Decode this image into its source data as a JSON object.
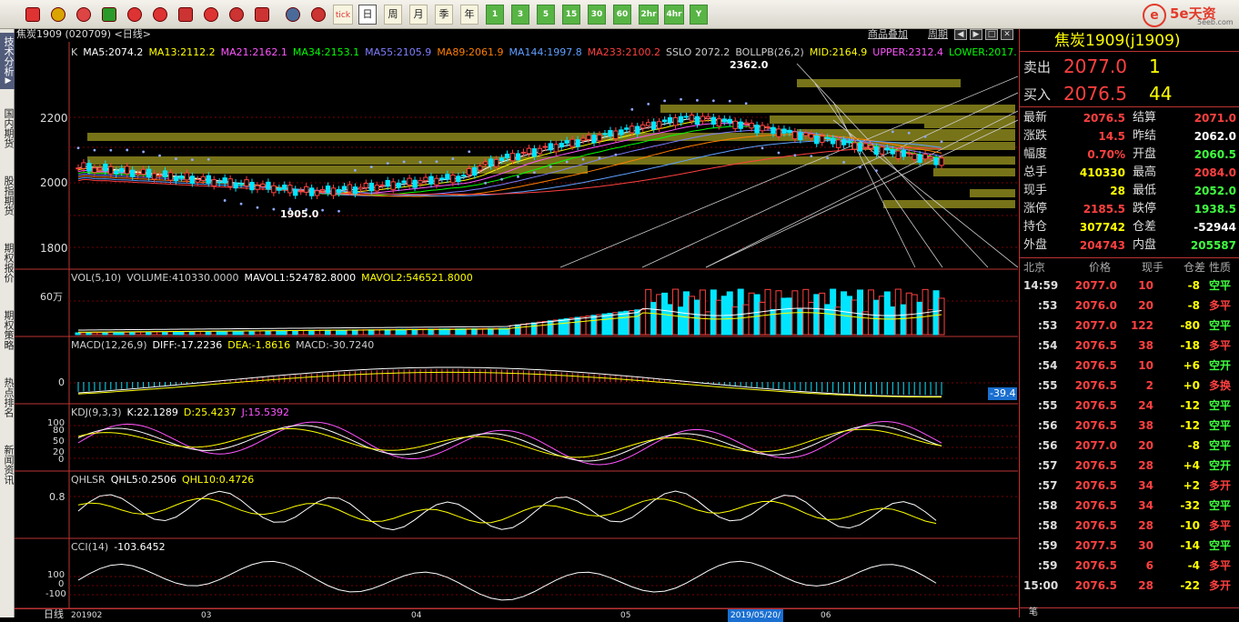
{
  "toolbar": {
    "buttons": [
      {
        "label": "",
        "icon": "home-icon",
        "kind": "ic"
      },
      {
        "label": "",
        "icon": "database-icon",
        "kind": "ic"
      },
      {
        "label": "",
        "icon": "f10-icon",
        "kind": "ic"
      },
      {
        "label": "",
        "icon": "refresh-icon",
        "kind": "ic"
      },
      {
        "label": "",
        "icon": "zoom-in-icon",
        "kind": "ic"
      },
      {
        "label": "",
        "icon": "zoom-out-icon",
        "kind": "ic"
      },
      {
        "label": "",
        "icon": "window-icon",
        "kind": "ic"
      },
      {
        "label": "",
        "icon": "pen-icon",
        "kind": "ic"
      },
      {
        "label": "",
        "icon": "edit-icon",
        "kind": "ic"
      },
      {
        "label": "",
        "icon": "filter-icon",
        "kind": "ic"
      },
      {
        "label": "",
        "icon": "table-icon",
        "kind": "ic"
      },
      {
        "label": "",
        "icon": "line-chart-icon",
        "kind": "ic"
      },
      {
        "label": "tick",
        "icon": "tick-icon",
        "kind": "tx"
      },
      {
        "label": "日",
        "kind": "tx",
        "selected": true
      },
      {
        "label": "周",
        "kind": "tx"
      },
      {
        "label": "月",
        "kind": "tx"
      },
      {
        "label": "季",
        "kind": "tx"
      },
      {
        "label": "年",
        "kind": "tx"
      },
      {
        "label": "1",
        "kind": "num"
      },
      {
        "label": "3",
        "kind": "num"
      },
      {
        "label": "5",
        "kind": "num"
      },
      {
        "label": "15",
        "kind": "num"
      },
      {
        "label": "30",
        "kind": "num"
      },
      {
        "label": "60",
        "kind": "num"
      },
      {
        "label": "2hr",
        "kind": "num"
      },
      {
        "label": "4hr",
        "kind": "num"
      },
      {
        "label": "Y",
        "kind": "num"
      }
    ]
  },
  "logo": {
    "mark": "e",
    "name": "5e天资",
    "site": "5eeb.com"
  },
  "leftbar": {
    "tabs": [
      "技术分析",
      "国内期货",
      "股指期货",
      "期权报价",
      "期权策略",
      "热点排名",
      "新闻资讯"
    ]
  },
  "chart": {
    "title": "焦炭1909 (020709) <日线>",
    "links": [
      "商品叠加",
      "周期"
    ],
    "main_legend": [
      {
        "t": "K",
        "c": "#cccccc"
      },
      {
        "t": "MA5:2074.2",
        "c": "#ffffff"
      },
      {
        "t": "MA13:2112.2",
        "c": "#ffff00"
      },
      {
        "t": "MA21:2162.1",
        "c": "#ff55ff"
      },
      {
        "t": "MA34:2153.1",
        "c": "#00ff00"
      },
      {
        "t": "MA55:2105.9",
        "c": "#7f7fff"
      },
      {
        "t": "MA89:2061.9",
        "c": "#ff7f00"
      },
      {
        "t": "MA144:1997.8",
        "c": "#5f9fff"
      },
      {
        "t": "MA233:2100.2",
        "c": "#ff4040"
      },
      {
        "t": "SSLO 2072.2",
        "c": "#cccccc"
      },
      {
        "t": "BOLLPB(26,2)",
        "c": "#cccccc"
      },
      {
        "t": "MID:2164.9",
        "c": "#ffff00"
      },
      {
        "t": "UPPER:2312.4",
        "c": "#ff55ff"
      },
      {
        "t": "LOWER:2017.",
        "c": "#00ff00"
      }
    ],
    "price_labels": [
      "2200",
      "2000",
      "1800"
    ],
    "high_mark": "2362.0",
    "low_mark": "1905.0",
    "vol_legend": [
      {
        "t": "VOL(5,10)",
        "c": "#cccccc"
      },
      {
        "t": "VOLUME:410330.0000",
        "c": "#cccccc"
      },
      {
        "t": "MAVOL1:524782.8000",
        "c": "#ffffff"
      },
      {
        "t": "MAVOL2:546521.8000",
        "c": "#ffff00"
      }
    ],
    "vol_label": "60万",
    "macd_legend": [
      {
        "t": "MACD(12,26,9)",
        "c": "#cccccc"
      },
      {
        "t": "DIFF:-17.2236",
        "c": "#ffffff"
      },
      {
        "t": "DEA:-1.8616",
        "c": "#ffff00"
      },
      {
        "t": "MACD:-30.7240",
        "c": "#cccccc"
      }
    ],
    "macd_label": "0",
    "macd_value": "-39.4",
    "kdj_legend": [
      {
        "t": "KDJ(9,3,3)",
        "c": "#cccccc"
      },
      {
        "t": "K:22.1289",
        "c": "#ffffff"
      },
      {
        "t": "D:25.4237",
        "c": "#ffff00"
      },
      {
        "t": "J:15.5392",
        "c": "#ff55ff"
      }
    ],
    "kdj_labels": [
      "100",
      "80",
      "50",
      "20",
      "0"
    ],
    "qhl_legend": [
      {
        "t": "QHLSR",
        "c": "#cccccc"
      },
      {
        "t": "QHL5:0.2506",
        "c": "#ffffff"
      },
      {
        "t": "QHL10:0.4726",
        "c": "#ffff00"
      }
    ],
    "qhl_label": "0.8",
    "cci_legend": [
      {
        "t": "CCI(14)",
        "c": "#cccccc"
      },
      {
        "t": "-103.6452",
        "c": "#ffffff"
      }
    ],
    "cci_labels": [
      "100",
      "0",
      "-100"
    ],
    "date_corner": "日线",
    "dates": [
      "201902",
      "03",
      "04",
      "05",
      "06"
    ],
    "date_cursor": "2019/05/20/"
  },
  "quote": {
    "name": "焦炭1909(j1909)",
    "sell": {
      "label": "卖出",
      "price": "2077.0",
      "vol": "1"
    },
    "buy": {
      "label": "买入",
      "price": "2076.5",
      "vol": "44"
    },
    "fields": [
      [
        {
          "k": "最新",
          "v": "2076.5",
          "vc": "#ff4040"
        },
        {
          "k": "结算",
          "v": "2071.0",
          "vc": "#ff4040"
        }
      ],
      [
        {
          "k": "涨跌",
          "v": "14.5",
          "vc": "#ff4040"
        },
        {
          "k": "昨结",
          "v": "2062.0",
          "vc": "#ffffff"
        }
      ],
      [
        {
          "k": "幅度",
          "v": "0.70%",
          "vc": "#ff4040"
        },
        {
          "k": "开盘",
          "v": "2060.5",
          "vc": "#40ff40"
        }
      ],
      [
        {
          "k": "总手",
          "v": "410330",
          "vc": "#ffff00"
        },
        {
          "k": "最高",
          "v": "2084.0",
          "vc": "#ff4040"
        }
      ],
      [
        {
          "k": "现手",
          "v": "28",
          "vc": "#ffff00"
        },
        {
          "k": "最低",
          "v": "2052.0",
          "vc": "#40ff40"
        }
      ],
      [
        {
          "k": "涨停",
          "v": "2185.5",
          "vc": "#ff4040"
        },
        {
          "k": "跌停",
          "v": "1938.5",
          "vc": "#40ff40"
        }
      ],
      [
        {
          "k": "持仓",
          "v": "307742",
          "vc": "#ffff00"
        },
        {
          "k": "仓差",
          "v": "-52944",
          "vc": "#ffffff"
        }
      ],
      [
        {
          "k": "外盘",
          "v": "204743",
          "vc": "#ff4040"
        },
        {
          "k": "内盘",
          "v": "205587",
          "vc": "#40ff40"
        }
      ]
    ],
    "tick_head": [
      "北京",
      "价格",
      "现手",
      "仓差",
      "性质"
    ],
    "ticks": [
      {
        "time": "14:59",
        "price": "2077.0",
        "vol": "10",
        "diff": "-8",
        "type": "空平",
        "tc": "#40ff40"
      },
      {
        "time": ":53",
        "price": "2076.0",
        "vol": "20",
        "diff": "-8",
        "type": "多平",
        "tc": "#ff4040"
      },
      {
        "time": ":53",
        "price": "2077.0",
        "vol": "122",
        "diff": "-80",
        "type": "空平",
        "tc": "#40ff40"
      },
      {
        "time": ":54",
        "price": "2076.5",
        "vol": "38",
        "diff": "-18",
        "type": "多平",
        "tc": "#ff4040"
      },
      {
        "time": ":54",
        "price": "2076.5",
        "vol": "10",
        "diff": "+6",
        "type": "空开",
        "tc": "#40ff40"
      },
      {
        "time": ":55",
        "price": "2076.5",
        "vol": "2",
        "diff": "+0",
        "type": "多换",
        "tc": "#ff4040"
      },
      {
        "time": ":55",
        "price": "2076.5",
        "vol": "24",
        "diff": "-12",
        "type": "空平",
        "tc": "#40ff40"
      },
      {
        "time": ":56",
        "price": "2076.5",
        "vol": "38",
        "diff": "-12",
        "type": "空平",
        "tc": "#40ff40"
      },
      {
        "time": ":56",
        "price": "2077.0",
        "vol": "20",
        "diff": "-8",
        "type": "空平",
        "tc": "#40ff40"
      },
      {
        "time": ":57",
        "price": "2076.5",
        "vol": "28",
        "diff": "+4",
        "type": "空开",
        "tc": "#40ff40"
      },
      {
        "time": ":57",
        "price": "2076.5",
        "vol": "34",
        "diff": "+2",
        "type": "多开",
        "tc": "#ff4040"
      },
      {
        "time": ":58",
        "price": "2076.5",
        "vol": "34",
        "diff": "-32",
        "type": "空平",
        "tc": "#40ff40"
      },
      {
        "time": ":58",
        "price": "2076.5",
        "vol": "28",
        "diff": "-10",
        "type": "多平",
        "tc": "#ff4040"
      },
      {
        "time": ":59",
        "price": "2077.5",
        "vol": "30",
        "diff": "-14",
        "type": "空平",
        "tc": "#40ff40"
      },
      {
        "time": ":59",
        "price": "2076.5",
        "vol": "6",
        "diff": "-4",
        "type": "多平",
        "tc": "#ff4040"
      },
      {
        "time": "15:00",
        "price": "2076.5",
        "vol": "28",
        "diff": "-22",
        "type": "多开",
        "tc": "#ff4040"
      }
    ],
    "footer": "笔"
  }
}
